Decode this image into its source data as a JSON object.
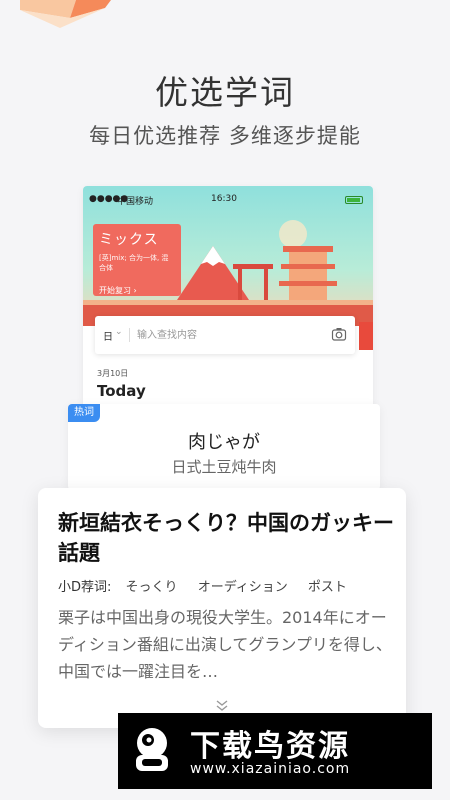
{
  "promo": {
    "headline": "优选学词",
    "subline": "每日优选推荐  多维逐步提能"
  },
  "phone": {
    "status": {
      "signal_dots": "●●●●●",
      "carrier": "中国移动",
      "time": "16:30"
    },
    "banner_card": {
      "title": "ミックス",
      "description": "[英]mix; 合为一体, 混合体",
      "button": "开始复习 ›"
    },
    "search": {
      "language": "日",
      "placeholder": "输入查找内容",
      "dropdown_icon": "chevron-down-icon",
      "camera_icon": "camera-icon"
    },
    "date": "3月10日",
    "today_label": "Today"
  },
  "hot_word": {
    "badge": "热词",
    "word": "肉じゃが",
    "meaning": "日式土豆炖牛肉"
  },
  "article": {
    "title": "新垣結衣そっくり？中国のガッキー話題",
    "tags_label": "小D荐词:",
    "tags": [
      "そっくり",
      "オーディション",
      "ポスト"
    ],
    "body": "栗子は中国出身の現役大学生。2014年にオーディション番組に出演してグランプリを得し、中国では一躍注目を…",
    "expand_icon": "double-chevron-down-icon"
  },
  "watermark": {
    "name": "下载鸟资源",
    "url": "www.xiazainiao.com"
  },
  "colors": {
    "accent_blue": "#3b8df1",
    "accent_red": "#f06a5e",
    "banner_teal": "#8fe0dc"
  }
}
